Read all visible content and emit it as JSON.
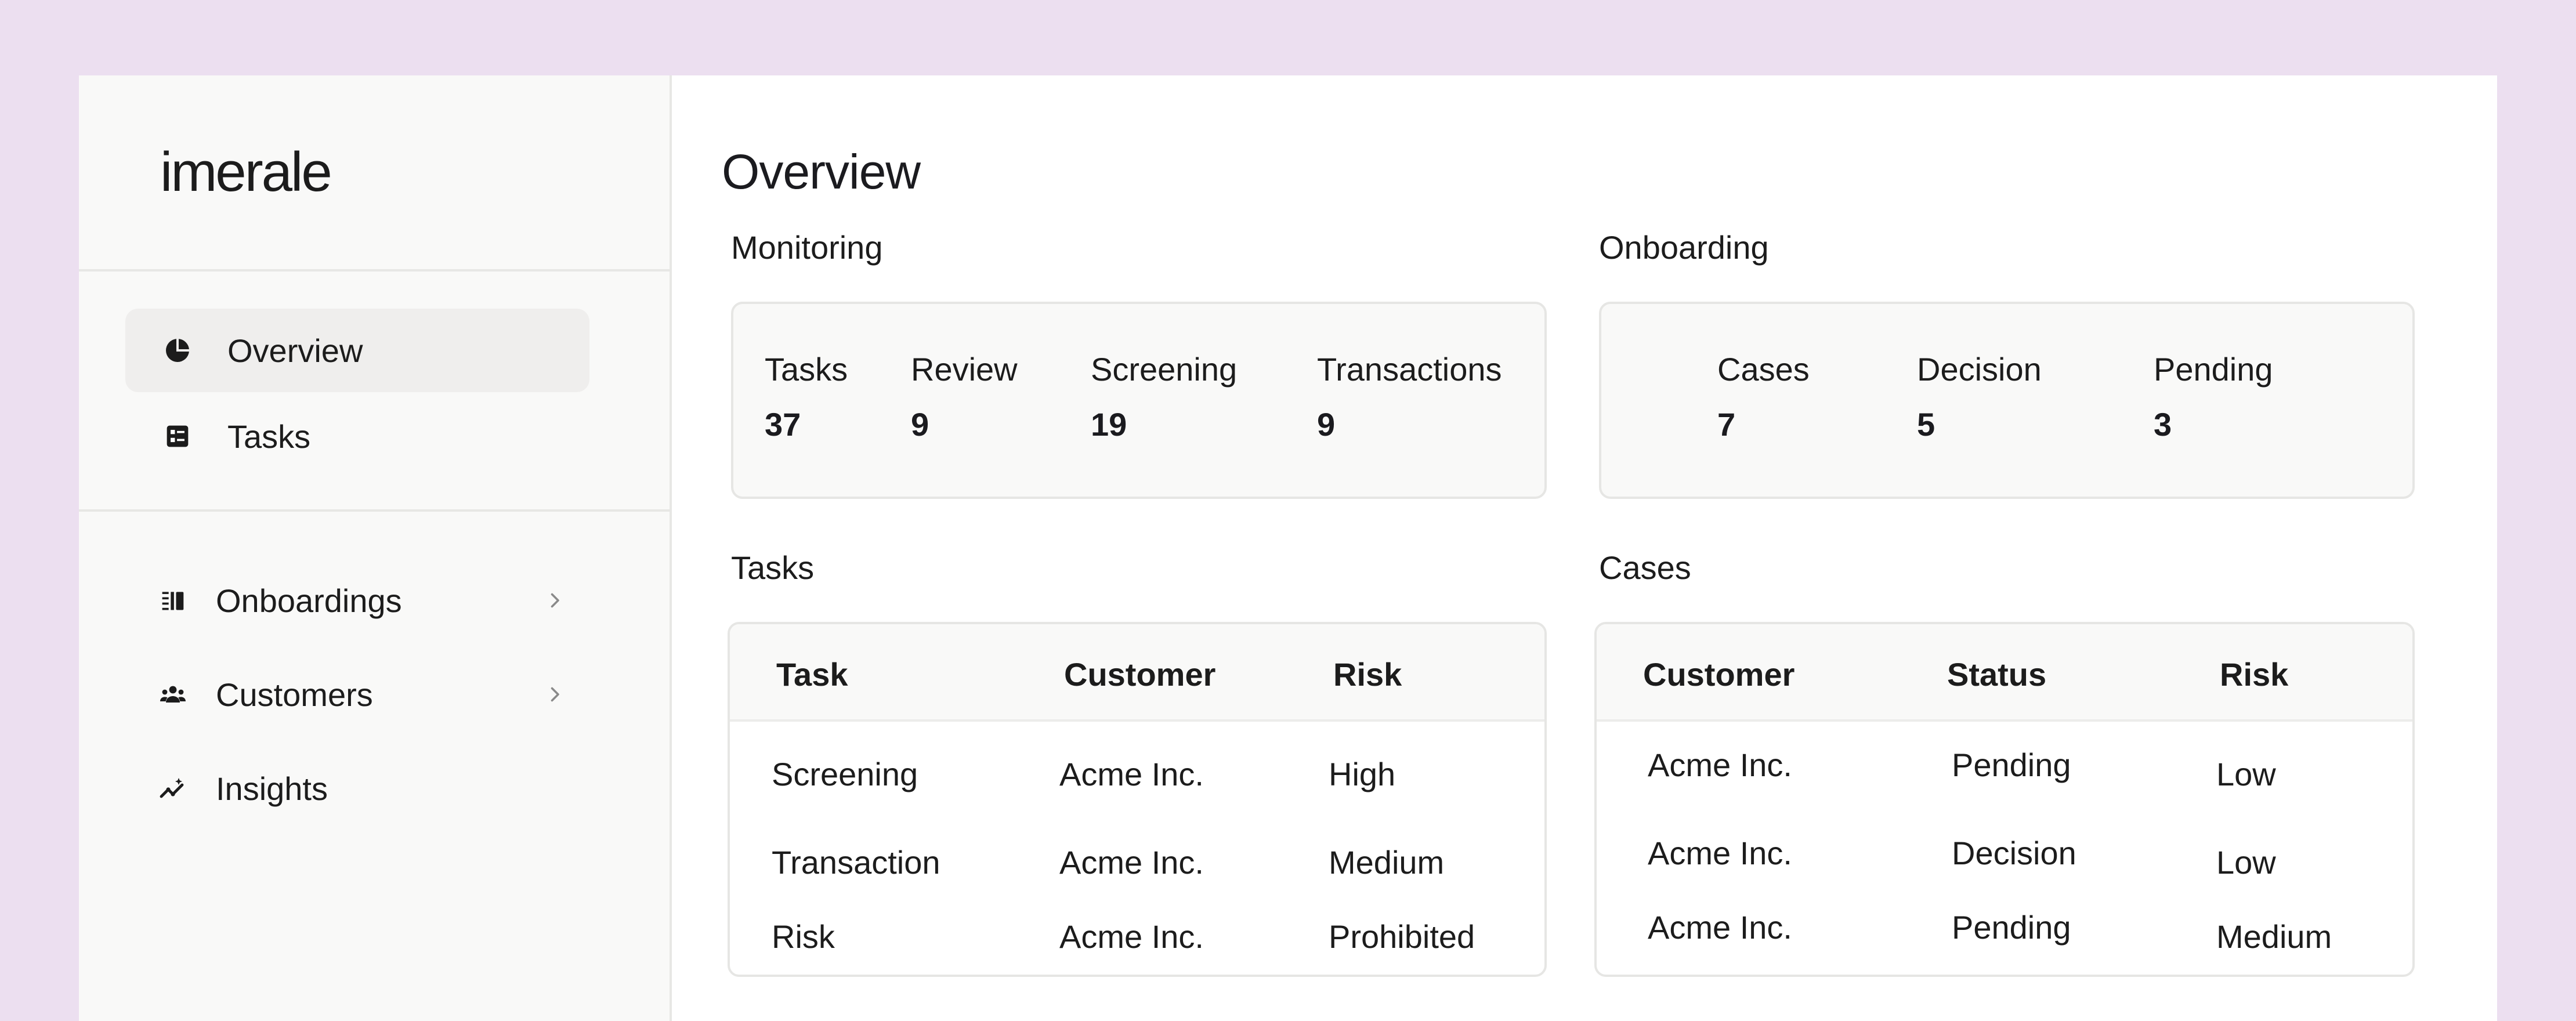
{
  "brand": {
    "name": "imerale"
  },
  "sidebar": {
    "primary": [
      {
        "label": "Overview",
        "icon": "pie-chart-icon",
        "active": true
      },
      {
        "label": "Tasks",
        "icon": "tasks-icon",
        "active": false
      }
    ],
    "secondary": [
      {
        "label": "Onboardings",
        "icon": "onboardings-icon",
        "has_chevron": true
      },
      {
        "label": "Customers",
        "icon": "customers-icon",
        "has_chevron": true
      },
      {
        "label": "Insights",
        "icon": "insights-icon",
        "has_chevron": false
      }
    ]
  },
  "main": {
    "title": "Overview",
    "monitoring": {
      "title": "Monitoring",
      "stats": [
        {
          "label": "Tasks",
          "value": "37"
        },
        {
          "label": "Review",
          "value": "9"
        },
        {
          "label": "Screening",
          "value": "19"
        },
        {
          "label": "Transactions",
          "value": "9"
        }
      ]
    },
    "onboarding": {
      "title": "Onboarding",
      "stats": [
        {
          "label": "Cases",
          "value": "7"
        },
        {
          "label": "Decision",
          "value": "5"
        },
        {
          "label": "Pending",
          "value": "3"
        }
      ]
    },
    "tasks_table": {
      "title": "Tasks",
      "columns": [
        "Task",
        "Customer",
        "Risk"
      ],
      "rows": [
        [
          "Screening",
          "Acme Inc.",
          "High"
        ],
        [
          "Transaction",
          "Acme Inc.",
          "Medium"
        ],
        [
          "Risk",
          "Acme Inc.",
          "Prohibited"
        ]
      ]
    },
    "cases_table": {
      "title": "Cases",
      "columns": [
        "Customer",
        "Status",
        "Risk"
      ],
      "rows": [
        [
          "Acme Inc.",
          "Pending",
          "Low"
        ],
        [
          "Acme Inc.",
          "Decision",
          "Low"
        ],
        [
          "Acme Inc.",
          "Pending",
          "Medium"
        ]
      ]
    }
  },
  "colors": {
    "background": "#ecdff0",
    "sidebar": "#f9f9f8",
    "active_nav": "#efeeed",
    "border": "#e6e6e4",
    "text": "#1c1c1c"
  }
}
